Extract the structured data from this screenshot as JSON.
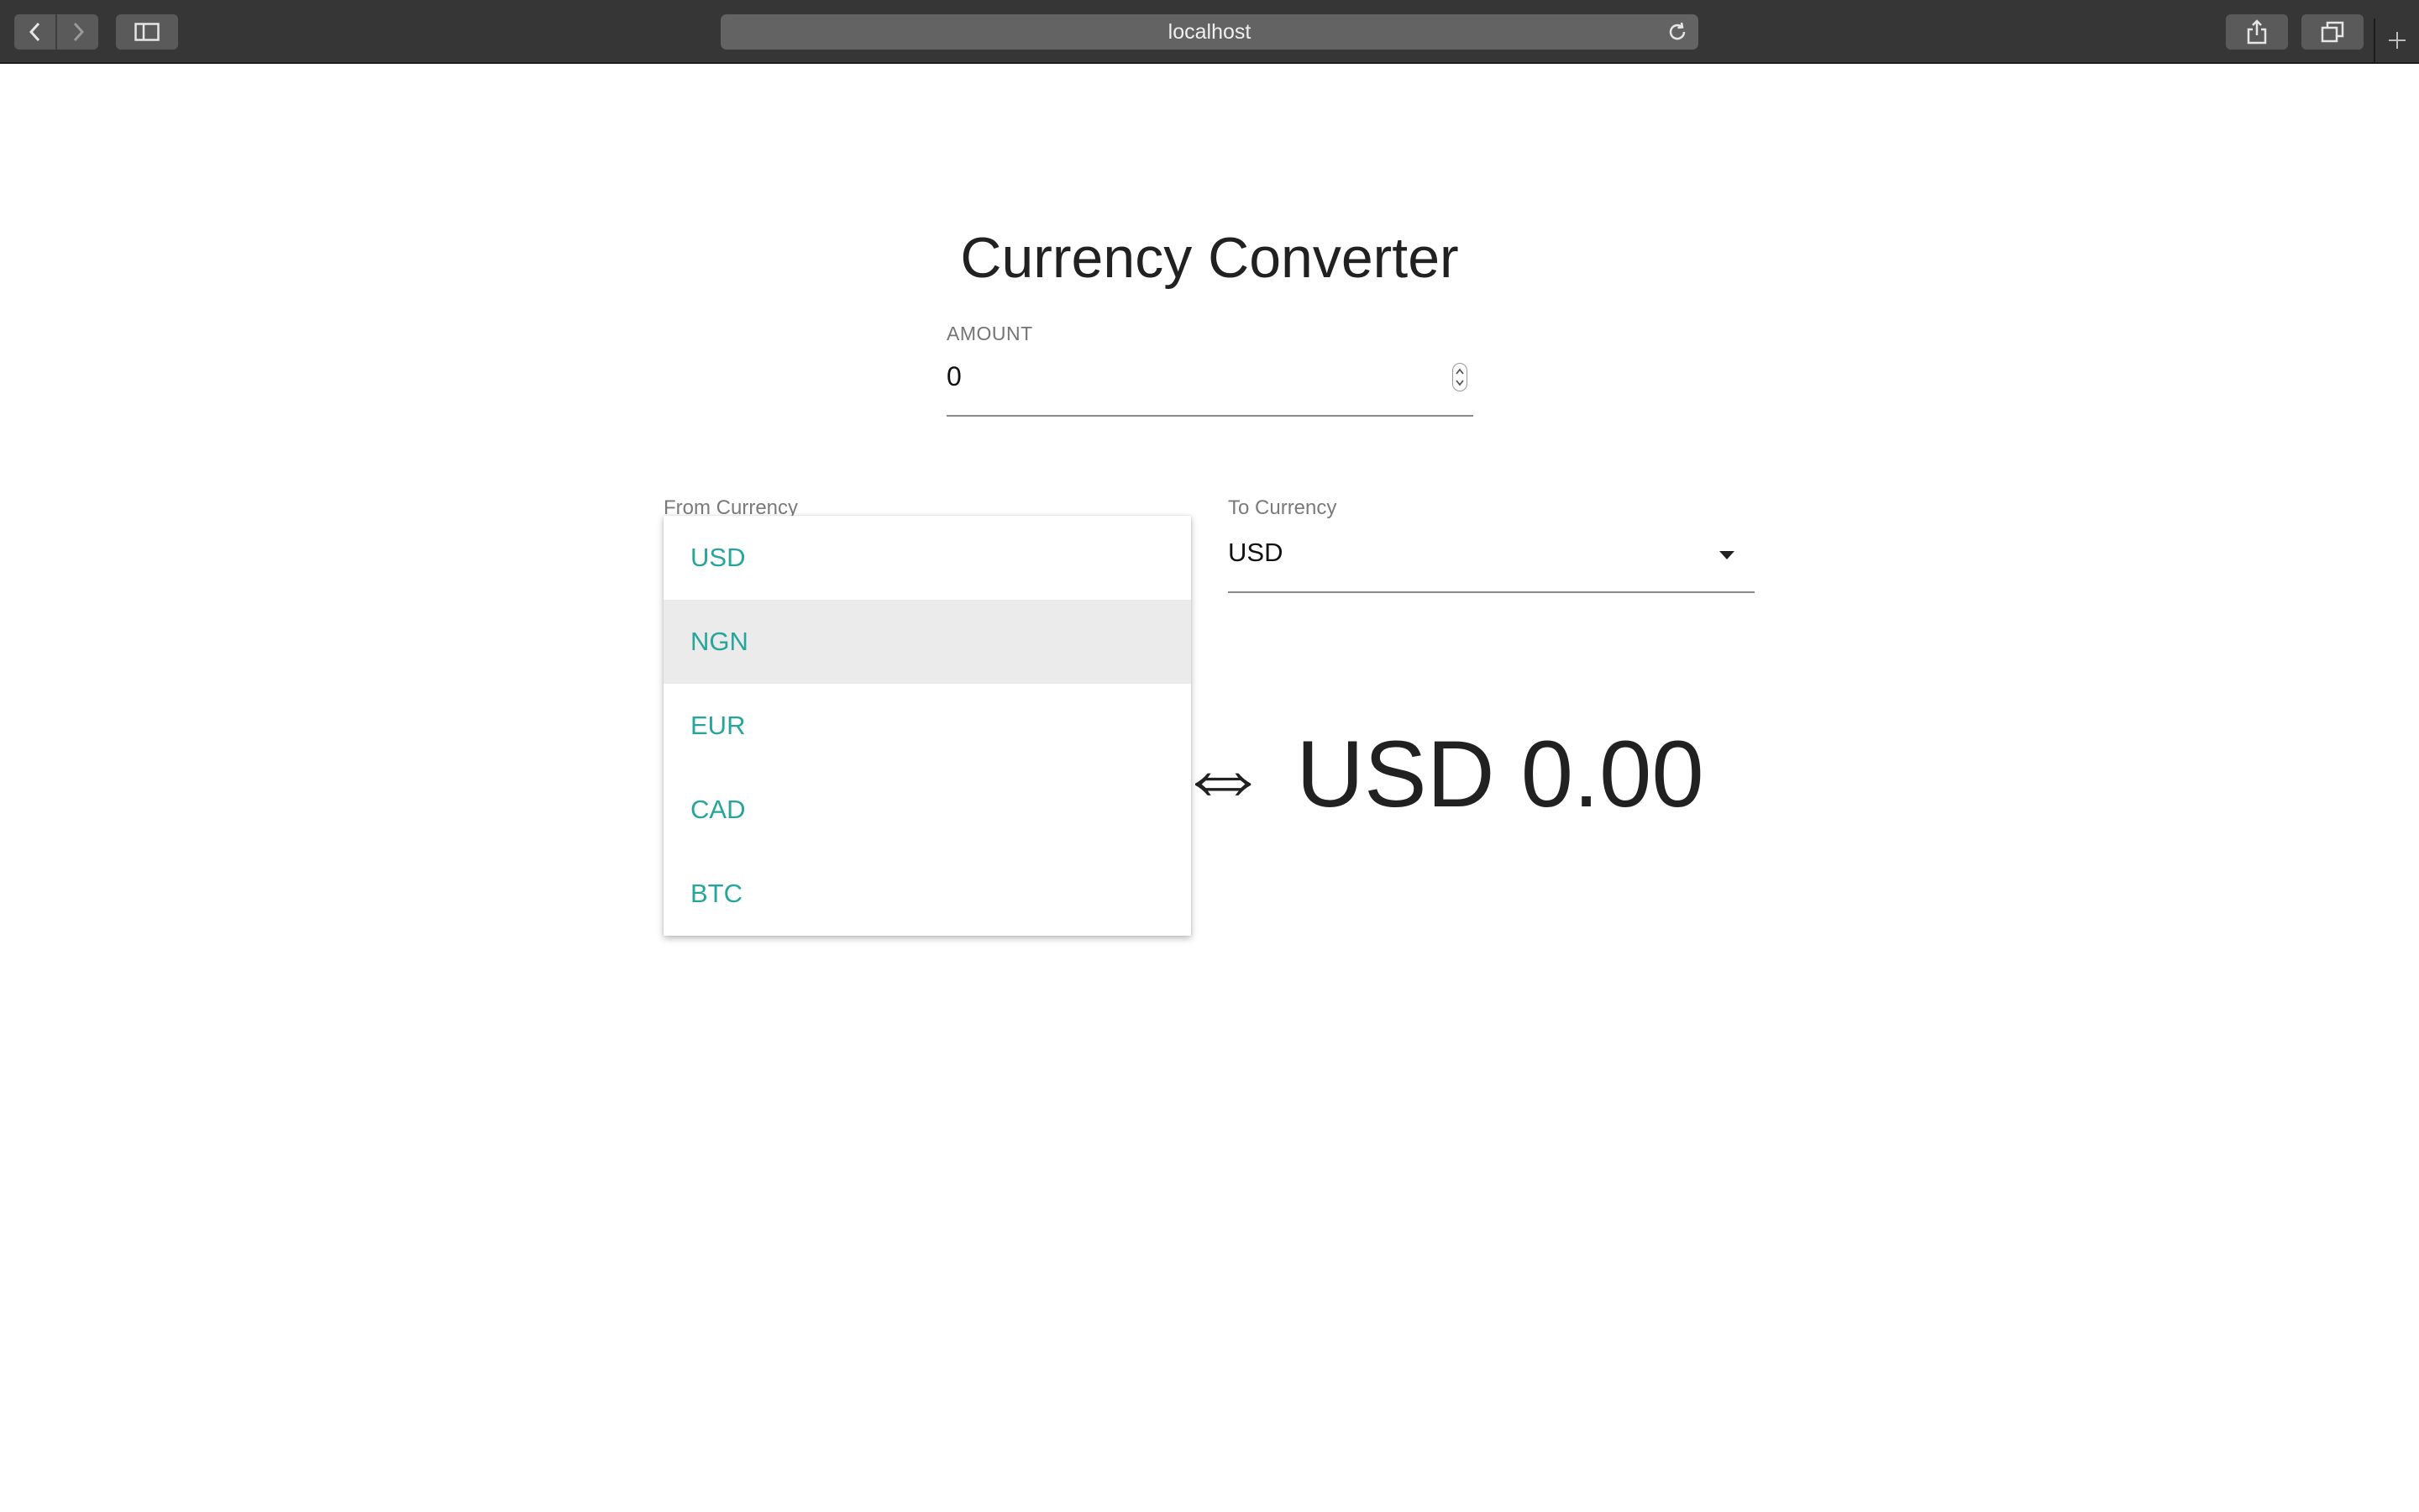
{
  "browser": {
    "url": "localhost"
  },
  "page": {
    "title": "Currency Converter"
  },
  "amount": {
    "label": "AMOUNT",
    "value": "0"
  },
  "from_currency": {
    "label": "From Currency",
    "options": [
      "USD",
      "NGN",
      "EUR",
      "CAD",
      "BTC"
    ],
    "highlighted": "NGN"
  },
  "to_currency": {
    "label": "To Currency",
    "value": "USD"
  },
  "result": {
    "text": "⇔ USD 0.00"
  },
  "colors": {
    "accent": "#26a69a",
    "toolbar": "#363636"
  }
}
